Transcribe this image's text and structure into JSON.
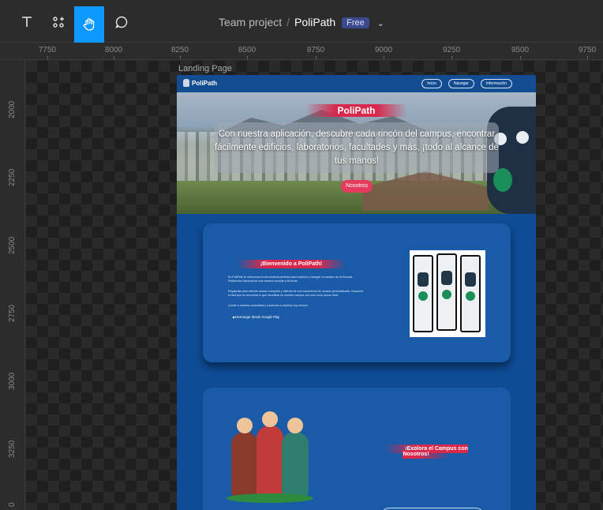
{
  "toolbar": {
    "project": "Team project",
    "separator": "/",
    "file": "PoliPath",
    "plan_badge": "Free",
    "tools": [
      "text-tool",
      "components-tool",
      "hand-tool",
      "comment-tool"
    ]
  },
  "rulers": {
    "horizontal": [
      "7750",
      "8000",
      "8250",
      "8500",
      "8750",
      "9000",
      "9250",
      "9500",
      "9750"
    ],
    "vertical": [
      "2000",
      "2250",
      "2500",
      "2750",
      "3000",
      "3250",
      "0"
    ]
  },
  "frame": {
    "label": "Landing Page",
    "navbar": {
      "logo": "PoliPath",
      "buttons": [
        "Inicio",
        "Navegar",
        "Información"
      ]
    },
    "hero": {
      "title": "PoliPath",
      "text": "Con nuestra aplicación, descubre cada rincón del campus, encontrar fácilmente edificios, laboratorios, facultades y más, ¡todo al alcance de tus manos!",
      "button": "Nosotros"
    },
    "welcome": {
      "title": "¡Bienvenido a PoliPath!",
      "p1": "En PoliPath te ofrecemos la herramienta perfecta para explorar y navegar el campus de la Escuela Politécnica Nacional de una manera sencilla y eficiente.",
      "p2": "Regístrate para obtener acceso completo y disfruta de una experiencia de usuario personalizada. Descubre lo fácil que es encontrar lo que necesitas en nuestro campus con solo unos pocos clics!",
      "p3": "¡Únete a nuestra comunidad y comienza a explorar hoy mismo!",
      "download": "Descargar desde Google Play"
    },
    "explore": {
      "title": "¡Explora el Campus con Nosotros!"
    }
  },
  "colors": {
    "accent": "#0d99ff",
    "page_blue": "#0f4c96",
    "card_blue": "#1a5ba7",
    "brand_red": "#d8284c"
  }
}
